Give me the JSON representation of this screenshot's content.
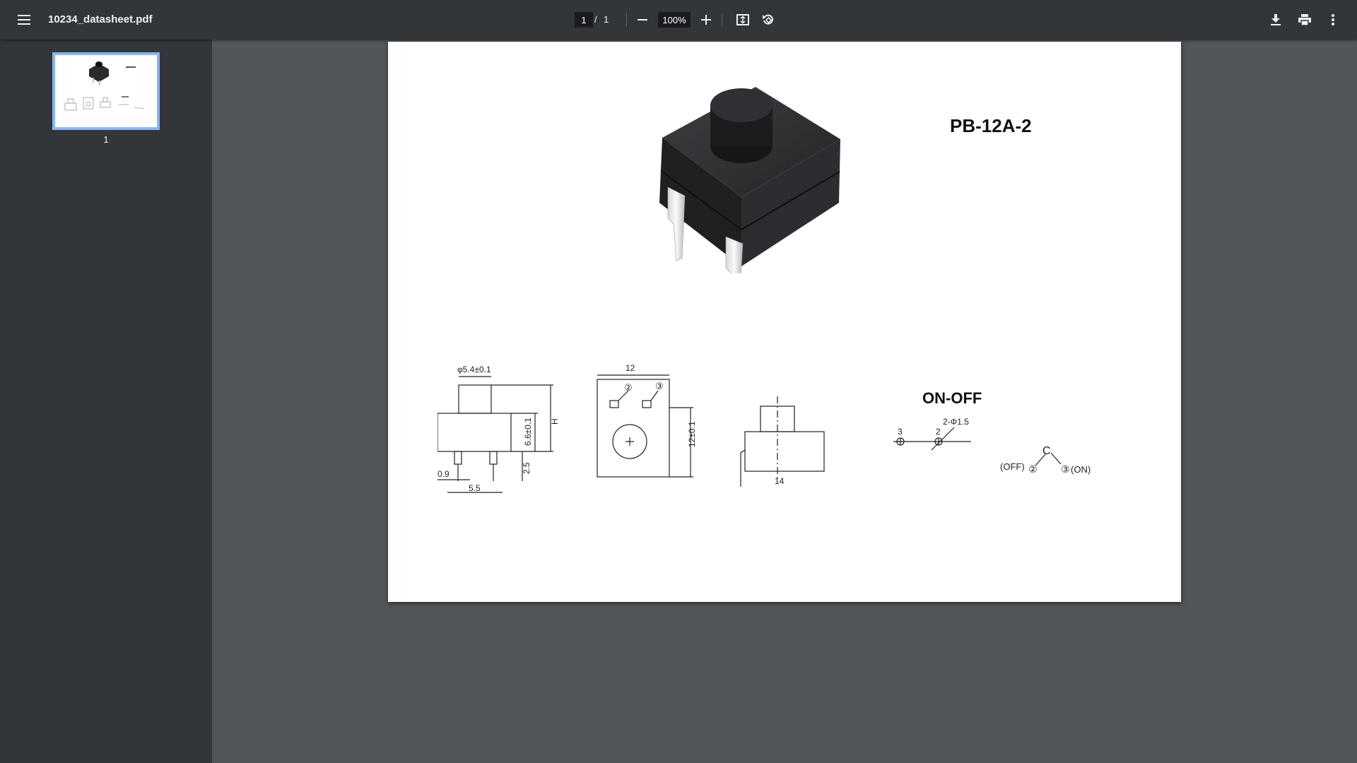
{
  "toolbar": {
    "file_name": "10234_datasheet.pdf",
    "current_page": "1",
    "page_separator": "/",
    "total_pages": "1",
    "zoom": "100%"
  },
  "sidebar": {
    "thumbnails": [
      {
        "page_label": "1"
      }
    ]
  },
  "document": {
    "part_number": "PB-12A-2",
    "switch_type": "ON-OFF",
    "dims": {
      "button_dia": "φ5.4±0.1",
      "pin_offset": "0.9",
      "pin_pitch": "5.5",
      "pin_length": "2.5",
      "body_height": "6.6±0.1",
      "total_height": "H",
      "top_width": "12",
      "side_height": "12±0.1",
      "side_width": "14",
      "pin_label_2": "2",
      "pin_label_3": "3",
      "hole_spec": "2-Φ1.5",
      "circle_2": "②",
      "circle_3": "③",
      "schem_common": "C",
      "schem_off": "(OFF)",
      "schem_on": "(ON)"
    }
  },
  "colors": {
    "toolbar_bg": "#323639",
    "sidebar_bg": "#323639",
    "viewer_bg": "#525659",
    "thumb_highlight": "#8ab4f8"
  },
  "icons": [
    "menu-icon",
    "minus-icon",
    "plus-icon",
    "fit-page-icon",
    "rotate-icon",
    "download-icon",
    "print-icon",
    "more-vert-icon"
  ]
}
